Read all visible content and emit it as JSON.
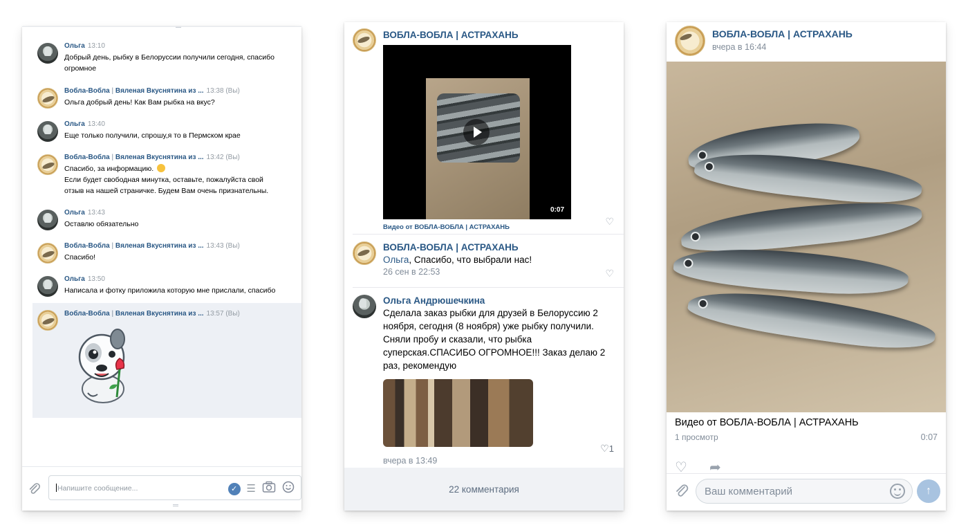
{
  "chat": {
    "messages": [
      {
        "author": "Ольга",
        "author_extra": "",
        "time": "13:10",
        "you": "",
        "lines": [
          "Добрый день, рыбку в Белоруссии получили сегодня, спасибо",
          "огромное"
        ]
      },
      {
        "author": "Вобла-Вобла",
        "author_extra": "Вяленая Вкуснятина из ...",
        "time": "13:38",
        "you": "(Вы)",
        "lines": [
          "Ольга добрый день! Как Вам рыбка на вкус?"
        ]
      },
      {
        "author": "Ольга",
        "author_extra": "",
        "time": "13:40",
        "you": "",
        "lines": [
          "Еще только получили, спрошу,я то в Пермском крае"
        ]
      },
      {
        "author": "Вобла-Вобла",
        "author_extra": "Вяленая Вкуснятина из ...",
        "time": "13:42",
        "you": "(Вы)",
        "lines": [
          "Спасибо, за информацию.",
          "Если будет свободная минутка, оставьте, пожалуйста свой",
          "отзыв на нашей страничке. Будем Вам очень признательны."
        ]
      },
      {
        "author": "Ольга",
        "author_extra": "",
        "time": "13:43",
        "you": "",
        "lines": [
          "Оставлю обязательно"
        ]
      },
      {
        "author": "Вобла-Вобла",
        "author_extra": "Вяленая Вкуснятина из ...",
        "time": "13:43",
        "you": "(Вы)",
        "lines": [
          "Спасибо!"
        ]
      },
      {
        "author": "Ольга",
        "author_extra": "",
        "time": "13:50",
        "you": "",
        "lines": [
          "Написала и фотку приложила которую мне прислали, спасибо"
        ]
      },
      {
        "author": "Вобла-Вобла",
        "author_extra": "Вяленая Вкуснятина из ...",
        "time": "13:57",
        "you": "(Вы)",
        "lines": []
      }
    ],
    "input_placeholder": "Напишите сообщение..."
  },
  "comments": {
    "post": {
      "author": "ВОБЛА-ВОБЛА | АСТРАХАНЬ",
      "video_duration": "0:07",
      "video_caption": "Видео от ВОБЛА-ВОБЛА | АСТРАХАНЬ"
    },
    "reply": {
      "author": "ВОБЛА-ВОБЛА | АСТРАХАНЬ",
      "mention": "Ольга",
      "text": ", Спасибо, что выбрали нас!",
      "date": "26 сен в 22:53"
    },
    "review": {
      "author": "Ольга Андрюшечкина",
      "text": "Сделала заказ рыбки для друзей в Белоруссию 2 ноября, сегодня (8 ноября) уже рыбку получили. Сняли пробу и сказали, что рыбка суперская.СПАСИБО ОГРОМНОЕ!!! Заказ делаю 2 раз, рекомендую",
      "date": "вчера в 13:49",
      "likes": "1"
    },
    "footer": "22 комментария"
  },
  "video": {
    "author": "ВОБЛА-ВОБЛА | АСТРАХАНЬ",
    "posted": "вчера в 16:44",
    "caption": "Видео от ВОБЛА-ВОБЛА | АСТРАХАНЬ",
    "views": "1 просмотр",
    "duration": "0:07",
    "comment_placeholder": "Ваш комментарий"
  },
  "colors": {
    "link": "#2a5885",
    "meta": "#818c99",
    "highlight": "#edf0f5",
    "send": "#a8c3e0"
  }
}
